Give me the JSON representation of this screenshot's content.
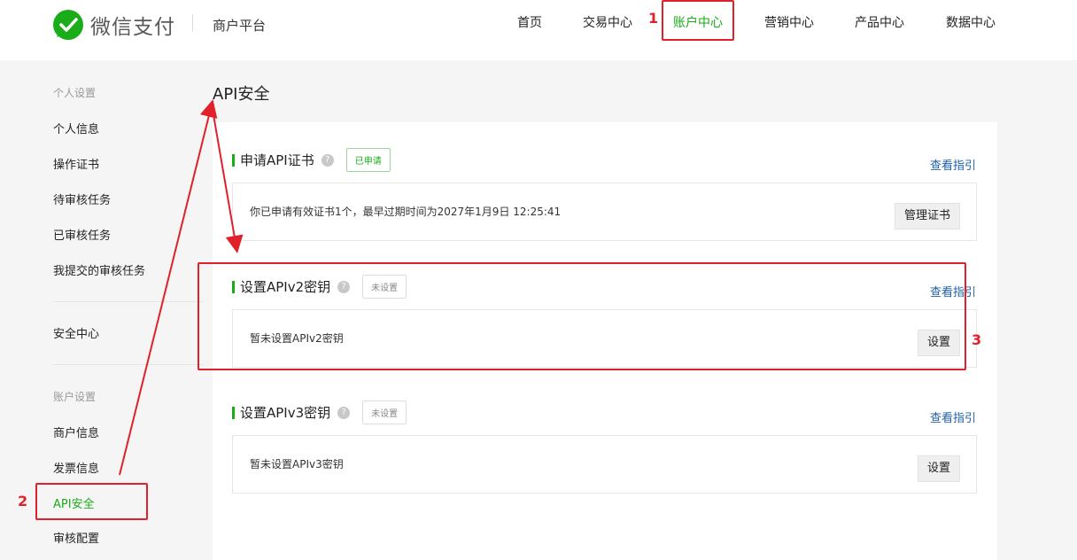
{
  "header": {
    "brand": "微信支付",
    "platform": "商户平台",
    "nav": [
      {
        "label": "首页"
      },
      {
        "label": "交易中心"
      },
      {
        "label": "账户中心"
      },
      {
        "label": "营销中心"
      },
      {
        "label": "产品中心"
      },
      {
        "label": "数据中心"
      }
    ]
  },
  "sidebar": {
    "group_personal": "个人设置",
    "items_personal": [
      {
        "label": "个人信息"
      },
      {
        "label": "操作证书"
      },
      {
        "label": "待审核任务"
      },
      {
        "label": "已审核任务"
      },
      {
        "label": "我提交的审核任务"
      }
    ],
    "security_center": "安全中心",
    "group_account": "账户设置",
    "items_account": [
      {
        "label": "商户信息"
      },
      {
        "label": "发票信息"
      },
      {
        "label": "API安全"
      },
      {
        "label": "审核配置"
      }
    ]
  },
  "main": {
    "title": "API安全",
    "sections": [
      {
        "title": "申请API证书",
        "help": "?",
        "tag": "已申请",
        "guide": "查看指引",
        "text": "你已申请有效证书1个，最早过期时间为2027年1月9日 12:25:41",
        "button": "管理证书"
      },
      {
        "title": "设置APIv2密钥",
        "help": "?",
        "tag": "未设置",
        "guide": "查看指引",
        "text": "暂未设置APIv2密钥",
        "button": "设置"
      },
      {
        "title": "设置APIv3密钥",
        "help": "?",
        "tag": "未设置",
        "guide": "查看指引",
        "text": "暂未设置APIv3密钥",
        "button": "设置"
      }
    ]
  },
  "annotations": {
    "labels": [
      "1",
      "2",
      "3"
    ],
    "color": "#e0202a"
  },
  "colors": {
    "accent": "#1aad19",
    "link": "#1f5fa8"
  }
}
